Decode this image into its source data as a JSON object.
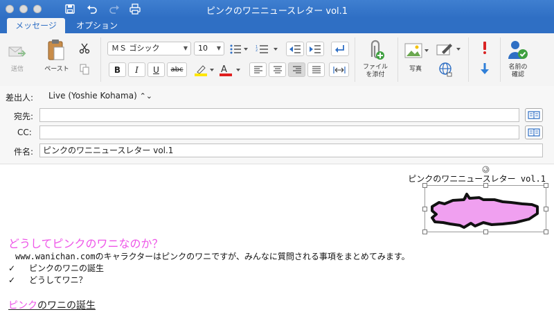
{
  "window": {
    "title": "ピンクのワニニュースレター vol.1"
  },
  "tabs": [
    {
      "label": "メッセージ",
      "active": true
    },
    {
      "label": "オプション",
      "active": false
    }
  ],
  "ribbon": {
    "send_label": "送信",
    "paste_label": "ペースト",
    "font_name": "ＭＳ ゴシック",
    "font_size": "10",
    "attach_label_1": "ファイル",
    "attach_label_2": "を添付",
    "photo_label": "写真",
    "check_names_label_1": "名前の",
    "check_names_label_2": "確認",
    "highlight_color": "#ffe600",
    "font_color": "#e02020"
  },
  "header": {
    "from_label": "差出人:",
    "from_value": "Live (Yoshie Kohama)",
    "to_label": "宛先:",
    "to_value": "",
    "cc_label": "CC:",
    "cc_value": "",
    "subject_label": "件名:",
    "subject_value": "ピンクのワニニュースレター vol.1"
  },
  "body": {
    "newsletter_title": "ピンクのワニニュースレター vol.1",
    "heading1": "どうしてピンクのワニなのか？",
    "intro_domain": "www.wanichan.com",
    "intro_text": "のキャラクターはピンクのワニですが、みんなに質問される事項をまとめてみます。",
    "checklist": [
      {
        "mark": "✓",
        "text": "ピンクのワニの誕生"
      },
      {
        "mark": "✓",
        "text": "どうしてワニ？"
      }
    ],
    "heading2_pink": "ピンク",
    "heading2_rest": "のワニの誕生",
    "accent_pink": "#ee55e8",
    "crocodile_fill": "#f0a0f0"
  }
}
